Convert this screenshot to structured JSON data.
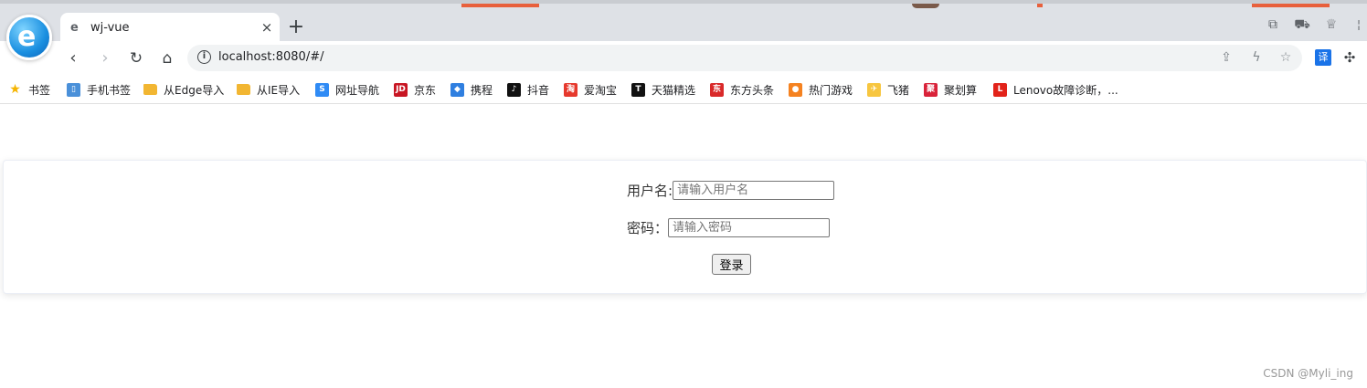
{
  "browser": {
    "tab": {
      "title": "wj-vue",
      "favicon": "edge-e-icon",
      "close": "×"
    },
    "new_tab": "+",
    "address": {
      "url": "localhost:8080/#/",
      "info_glyph": "i"
    }
  },
  "bookmarks": [
    {
      "label": "书签",
      "icon": "star-icon",
      "color": "#f5b400",
      "glyph": "★"
    },
    {
      "label": "手机书签",
      "icon": "phone-icon",
      "color": "#4a90d9",
      "glyph": "▯"
    },
    {
      "label": "从Edge导入",
      "icon": "folder-icon",
      "color": "#f2b632",
      "glyph": ""
    },
    {
      "label": "从IE导入",
      "icon": "folder-icon",
      "color": "#f2b632",
      "glyph": ""
    },
    {
      "label": "网址导航",
      "icon": "nav-icon",
      "color": "#2f8bf5",
      "glyph": "S"
    },
    {
      "label": "京东",
      "icon": "jd-icon",
      "color": "#c81623",
      "glyph": "JD"
    },
    {
      "label": "携程",
      "icon": "ctrip-icon",
      "color": "#2f7fe0",
      "glyph": "◆"
    },
    {
      "label": "抖音",
      "icon": "douyin-icon",
      "color": "#111111",
      "glyph": "♪"
    },
    {
      "label": "爱淘宝",
      "icon": "taobao-icon",
      "color": "#e6392d",
      "glyph": "淘"
    },
    {
      "label": "天猫精选",
      "icon": "tmall-icon",
      "color": "#111111",
      "glyph": "T"
    },
    {
      "label": "东方头条",
      "icon": "dftt-icon",
      "color": "#d92929",
      "glyph": "东方"
    },
    {
      "label": "热门游戏",
      "icon": "game-icon",
      "color": "#f58220",
      "glyph": "●"
    },
    {
      "label": "飞猪",
      "icon": "fliggy-icon",
      "color": "#f7c640",
      "glyph": "✈"
    },
    {
      "label": "聚划算",
      "icon": "juhuasuan-icon",
      "color": "#d9233a",
      "glyph": "聚"
    },
    {
      "label": "Lenovo故障诊断，...",
      "icon": "lenovo-icon",
      "color": "#e2231a",
      "glyph": "L"
    }
  ],
  "login": {
    "username_label": "用户名:",
    "username_placeholder": "请输入用户名",
    "password_label": "密码：",
    "password_placeholder": "请输入密码",
    "submit_label": "登录"
  },
  "watermark": "CSDN @Myli_ing"
}
